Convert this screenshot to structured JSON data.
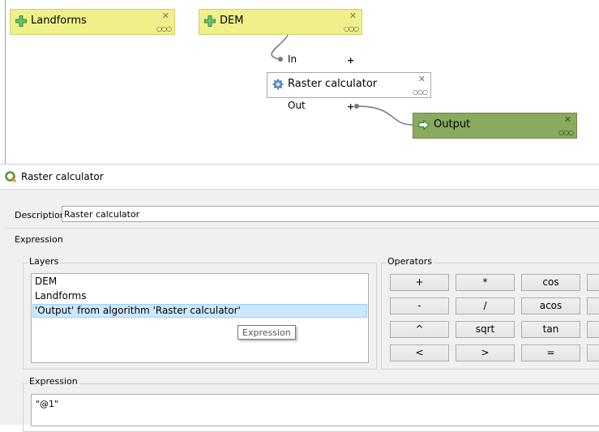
{
  "model": {
    "inputs": [
      {
        "label": "Landforms"
      },
      {
        "label": "DEM"
      }
    ],
    "algorithm": {
      "label": "Raster calculator",
      "input_port": "In",
      "output_port": "Out"
    },
    "output": {
      "label": "Output"
    },
    "port_plus": "+"
  },
  "dialog": {
    "title": "Raster calculator",
    "description_label": "Description",
    "description_value": "Raster calculator",
    "expression_section": "Expression",
    "layers_title": "Layers",
    "layers": [
      "DEM",
      "Landforms",
      "'Output' from algorithm 'Raster calculator'"
    ],
    "selected_layer_index": 2,
    "tooltip": "Expression",
    "operators_title": "Operators",
    "operators": [
      [
        "+",
        "*",
        "cos"
      ],
      [
        "-",
        "/",
        "acos"
      ],
      [
        "^",
        "sqrt",
        "tan"
      ],
      [
        "<",
        ">",
        "="
      ]
    ],
    "expression_title": "Expression",
    "expression_value": "\"@1\""
  },
  "colors": {
    "input_node": "#f0f08a",
    "output_node": "#8aaa5e",
    "selection": "#cce8ff"
  },
  "icons": [
    "plus-param-icon",
    "gear-icon",
    "arrow-output-icon",
    "close-icon",
    "more-dots-icon",
    "qgis-logo-icon"
  ]
}
